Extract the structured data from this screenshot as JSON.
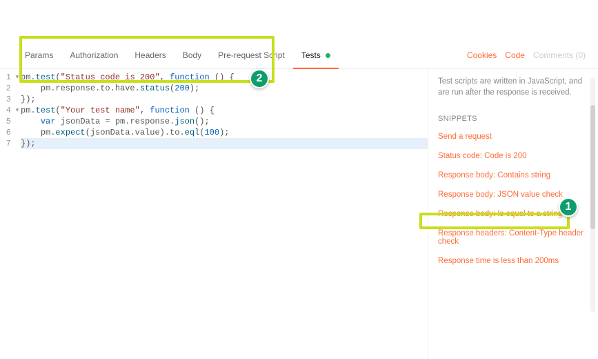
{
  "tabs": {
    "params": "Params",
    "auth": "Authorization",
    "headers": "Headers",
    "body": "Body",
    "prereq": "Pre-request Script",
    "tests": "Tests"
  },
  "rightLinks": {
    "cookies": "Cookies",
    "code": "Code",
    "comments": "Comments (0)"
  },
  "editor": {
    "lineNumbers": [
      "1",
      "2",
      "3",
      "4",
      "5",
      "6",
      "7"
    ],
    "lines": {
      "l1_a": "pm.",
      "l1_b": "test",
      "l1_c": "(",
      "l1_d": "\"Status code is 200\"",
      "l1_e": ", ",
      "l1_f": "function",
      "l1_g": " () {",
      "l2_a": "    pm.response.to.have.",
      "l2_b": "status",
      "l2_c": "(",
      "l2_d": "200",
      "l2_e": ");",
      "l3": "});",
      "l4_a": "pm.",
      "l4_b": "test",
      "l4_c": "(",
      "l4_d": "\"Your test name\"",
      "l4_e": ", ",
      "l4_f": "function",
      "l4_g": " () {",
      "l5_a": "    ",
      "l5_b": "var",
      "l5_c": " jsonData = pm.response.",
      "l5_d": "json",
      "l5_e": "();",
      "l6_a": "    pm.",
      "l6_b": "expect",
      "l6_c": "(jsonData.value).to.",
      "l6_d": "eql",
      "l6_e": "(",
      "l6_f": "100",
      "l6_g": ");",
      "l7": "});"
    }
  },
  "sidebar": {
    "helper": "Test scripts are written in JavaScript, and are run after the response is received.",
    "heading": "SNIPPETS",
    "snippets": {
      "s1": "Send a request",
      "s2": "Status code: Code is 200",
      "s3": "Response body: Contains string",
      "s4": "Response body: JSON value check",
      "s5": "Response body: Is equal to a string",
      "s6": "Response headers: Content-Type header check",
      "s7": "Response time is less than 200ms"
    }
  },
  "badges": {
    "one": "1",
    "two": "2"
  }
}
